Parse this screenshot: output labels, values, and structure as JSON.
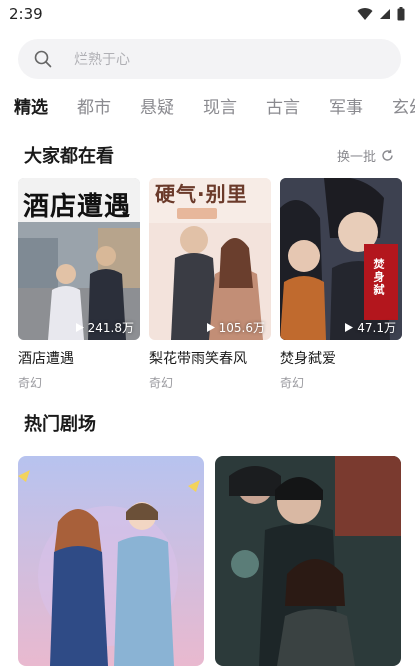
{
  "status_bar": {
    "time": "2:39"
  },
  "search": {
    "placeholder": "烂熟于心"
  },
  "tabs": [
    {
      "label": "精选",
      "active": true
    },
    {
      "label": "都市"
    },
    {
      "label": "悬疑"
    },
    {
      "label": "现言"
    },
    {
      "label": "古言"
    },
    {
      "label": "军事"
    },
    {
      "label": "玄幻"
    }
  ],
  "section_watching": {
    "title": "大家都在看",
    "refresh_label": "换一批",
    "cards": [
      {
        "title": "酒店遭遇",
        "tag": "奇幻",
        "views": "241.8万",
        "poster_text": "酒店遭遇"
      },
      {
        "title": "梨花带雨笑春风",
        "tag": "奇幻",
        "views": "105.6万",
        "poster_text": "硬气·别里"
      },
      {
        "title": "焚身弑爱",
        "tag": "奇幻",
        "views": "47.1万",
        "poster_text": "焚身弑"
      }
    ]
  },
  "section_hot": {
    "title": "热门剧场"
  },
  "colors": {
    "accent_underline": "#cfeee7"
  }
}
